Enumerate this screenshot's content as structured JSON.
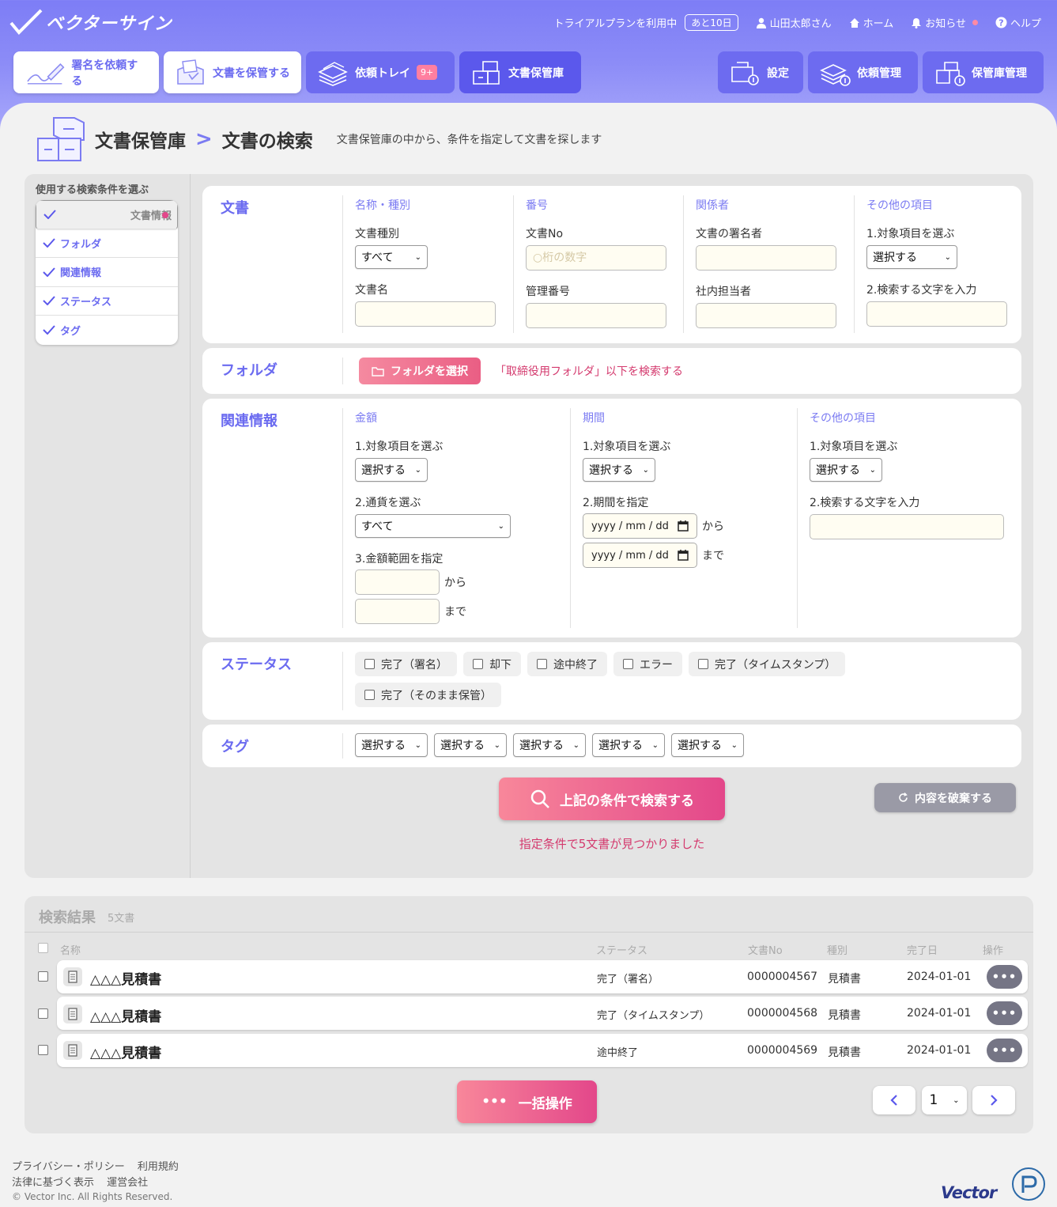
{
  "header": {
    "logo_text": "ベクターサイン",
    "trial_text": "トライアルプランを利用中",
    "trial_days": "あと10日",
    "user": "山田太郎さん",
    "home": "ホーム",
    "notice": "お知らせ",
    "help": "ヘルプ"
  },
  "tabs": [
    {
      "label": "署名を依頼する"
    },
    {
      "label": "文書を保管する"
    },
    {
      "label": "依頼トレイ",
      "badge": "9+"
    },
    {
      "label": "文書保管庫"
    }
  ],
  "right_tabs": [
    {
      "label": "設定"
    },
    {
      "label": "依頼管理"
    },
    {
      "label": "保管庫管理"
    }
  ],
  "page": {
    "title": "文書保管庫",
    "subtitle": "文書の検索",
    "description": "文書保管庫の中から、条件を指定して文書を探します"
  },
  "sidebar": {
    "label": "使用する検索条件を選ぶ",
    "items": [
      "文書情報",
      "フォルダ",
      "関連情報",
      "ステータス",
      "タグ"
    ]
  },
  "document_card": {
    "title": "文書",
    "col1": {
      "header": "名称・種別",
      "type_label": "文書種別",
      "type_value": "すべて",
      "name_label": "文書名"
    },
    "col2": {
      "header": "番号",
      "no_label": "文書No",
      "no_placeholder": "○桁の数字",
      "mgmt_label": "管理番号"
    },
    "col3": {
      "header": "関係者",
      "signer_label": "文書の署名者",
      "staff_label": "社内担当者"
    },
    "col4": {
      "header": "その他の項目",
      "item_label": "1.対象項目を選ぶ",
      "item_value": "選択する",
      "text_label": "2.検索する文字を入力"
    }
  },
  "folder_card": {
    "title": "フォルダ",
    "button": "フォルダを選択",
    "selected_text": "「取締役用フォルダ」以下を検索する"
  },
  "related_card": {
    "title": "関連情報",
    "amount": {
      "header": "金額",
      "item_label": "1.対象項目を選ぶ",
      "item_value": "選択する",
      "currency_label": "2.通貨を選ぶ",
      "currency_value": "すべて",
      "range_label": "3.金額範囲を指定",
      "from": "から",
      "to": "まで"
    },
    "period": {
      "header": "期間",
      "item_label": "1.対象項目を選ぶ",
      "item_value": "選択する",
      "range_label": "2.期間を指定",
      "date_placeholder": "yyyy / mm / dd",
      "from": "から",
      "to": "まで"
    },
    "other": {
      "header": "その他の項目",
      "item_label": "1.対象項目を選ぶ",
      "item_value": "選択する",
      "text_label": "2.検索する文字を入力"
    }
  },
  "status_card": {
    "title": "ステータス",
    "options": [
      "完了（署名）",
      "却下",
      "途中終了",
      "エラー",
      "完了（タイムスタンプ）",
      "完了（そのまま保管）"
    ]
  },
  "tag_card": {
    "title": "タグ",
    "selects": [
      "選択する",
      "選択する",
      "選択する",
      "選択する",
      "選択する"
    ]
  },
  "search_button": "上記の条件で検索する",
  "clear_button": "内容を破棄する",
  "found_message": "指定条件で5文書が見つかりました",
  "results": {
    "title": "検索結果",
    "count": "5文書",
    "columns": {
      "name": "名称",
      "status": "ステータス",
      "no": "文書No",
      "type": "種別",
      "date": "完了日",
      "action": "操作"
    },
    "rows": [
      {
        "name": "△△△見積書",
        "status": "完了（署名）",
        "no": "0000004567",
        "type": "見積書",
        "date": "2024-01-01"
      },
      {
        "name": "△△△見積書",
        "status": "完了（タイムスタンプ）",
        "no": "0000004568",
        "type": "見積書",
        "date": "2024-01-01"
      },
      {
        "name": "△△△見積書",
        "status": "途中終了",
        "no": "0000004569",
        "type": "見積書",
        "date": "2024-01-01"
      }
    ],
    "more_label": "•••",
    "bulk_button": "一括操作",
    "page_value": "1"
  },
  "footer": {
    "privacy": "プライバシー・ポリシー",
    "terms": "利用規約",
    "law": "法律に基づく表示",
    "company": "運営会社",
    "copyright": "© Vector Inc. All Rights Reserved.",
    "brand": "Vector"
  },
  "colors": {
    "accent": "#6b6bf0",
    "pink": "#e3478a",
    "input_bg": "#fffdf2"
  }
}
